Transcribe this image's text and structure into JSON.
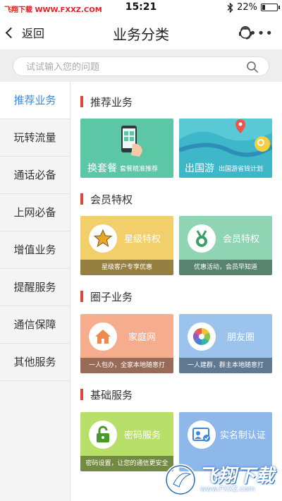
{
  "status_bar": {
    "watermark": "飞翔下载 WWW.FXXZ.COM",
    "time": "15:21",
    "battery": "22%",
    "battery_level": 0.22
  },
  "nav": {
    "back_label": "返回",
    "title": "业务分类"
  },
  "search": {
    "placeholder": "试试输入您的问题"
  },
  "sidebar": {
    "items": [
      {
        "label": "推荐业务"
      },
      {
        "label": "玩转流量"
      },
      {
        "label": "通话必备"
      },
      {
        "label": "上网必备"
      },
      {
        "label": "增值业务"
      },
      {
        "label": "提醒服务"
      },
      {
        "label": "通信保障"
      },
      {
        "label": "其他服务"
      }
    ]
  },
  "sections": [
    {
      "title": "推荐业务",
      "cards": [
        {
          "title": "换套餐",
          "caption": "套餐精准推荐",
          "color": "#5cc7a5"
        },
        {
          "title": "出国游",
          "caption": "出国游省钱计划",
          "color": "#3eb7c9"
        }
      ]
    },
    {
      "title": "会员特权",
      "cards": [
        {
          "title": "星级特权",
          "caption": "星级客户专享优惠",
          "color": "#f2cf6a"
        },
        {
          "title": "会员特权",
          "caption": "优惠活动，会员早知道",
          "color": "#8fd4b3"
        }
      ]
    },
    {
      "title": "圈子业务",
      "cards": [
        {
          "title": "家庭网",
          "caption": "一人包办，全家本地随意打",
          "color": "#f6ad8e"
        },
        {
          "title": "朋友圈",
          "caption": "一人建群，群主本地随意打",
          "color": "#9cc3ec"
        }
      ]
    },
    {
      "title": "基础服务",
      "cards": [
        {
          "title": "密码服务",
          "caption": "密码设置，让您的通信更安全",
          "color": "#b8df6a"
        },
        {
          "title": "实名制认证",
          "caption": "",
          "color": "#8eb7ea"
        }
      ]
    }
  ],
  "watermark": {
    "brand": "飞翔下载",
    "url": "www.FXXZ.com"
  },
  "colors": {
    "accent": "#3d88d8",
    "section_bar": "#e1453a"
  }
}
